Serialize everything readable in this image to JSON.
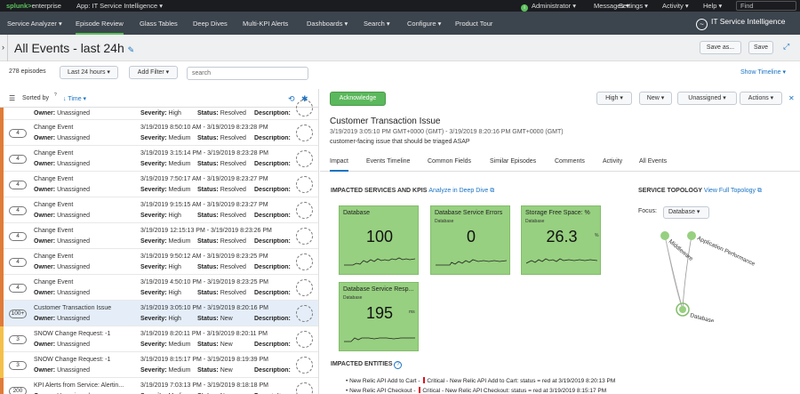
{
  "topbar": {
    "logo_a": "splunk>",
    "logo_b": "enterprise",
    "app": "App: IT Service Intelligence ▾",
    "admin_icon": "i",
    "admin": "Administrator ▾",
    "messages": "Messages ▾",
    "settings": "Settings ▾",
    "activity": "Activity ▾",
    "help": "Help ▾",
    "find": "Find"
  },
  "nav": {
    "items": [
      "Service Analyzer ▾",
      "Episode Review",
      "Glass Tables",
      "Deep Dives",
      "Multi-KPI Alerts",
      "Dashboards ▾",
      "Search ▾",
      "Configure ▾",
      "Product Tour"
    ],
    "brand": "IT Service Intelligence",
    "brand_icon": "~"
  },
  "title": {
    "text": "All Events - last 24h",
    "edit_icon": "✎",
    "save_as": "Save as...",
    "save": "Save",
    "expand_icon": "⤢"
  },
  "toolbar": {
    "count": "278 episodes",
    "time": "Last 24 hours ▾",
    "filter": "Add Filter ▾",
    "search_placeholder": "search",
    "show_timeline": "Show Timeline ▾"
  },
  "list": {
    "sort_icon": "☰",
    "sorted_by": "Sorted by",
    "sort_q": "?",
    "sort_field": "↓ Time ▾",
    "refresh_icon": "⟲",
    "settings_icon": "✱",
    "labels": {
      "owner": "Owner:",
      "severity": "Severity:",
      "status": "Status:",
      "description": "Description:"
    },
    "rows": [
      {
        "badge": "",
        "title": "",
        "time": "",
        "owner": "Unassigned",
        "severity": "High",
        "status": "Resolved",
        "desc": "",
        "color": "#e07b39"
      },
      {
        "badge": "4",
        "title": "Change Event",
        "time": "3/19/2019 8:50:10 AM - 3/19/2019 8:23:28 PM",
        "owner": "Unassigned",
        "severity": "Medium",
        "status": "Resolved",
        "desc": "",
        "color": "#e07b39"
      },
      {
        "badge": "4",
        "title": "Change Event",
        "time": "3/19/2019 3:15:14 PM - 3/19/2019 8:23:28 PM",
        "owner": "Unassigned",
        "severity": "Medium",
        "status": "Resolved",
        "desc": "",
        "color": "#e07b39"
      },
      {
        "badge": "4",
        "title": "Change Event",
        "time": "3/19/2019 7:50:17 AM - 3/19/2019 8:23:27 PM",
        "owner": "Unassigned",
        "severity": "Medium",
        "status": "Resolved",
        "desc": "",
        "color": "#e07b39"
      },
      {
        "badge": "4",
        "title": "Change Event",
        "time": "3/19/2019 9:15:15 AM - 3/19/2019 8:23:27 PM",
        "owner": "Unassigned",
        "severity": "High",
        "status": "Resolved",
        "desc": "",
        "color": "#e07b39"
      },
      {
        "badge": "4",
        "title": "Change Event",
        "time": "3/19/2019 12:15:13 PM - 3/19/2019 8:23:26 PM",
        "owner": "Unassigned",
        "severity": "Medium",
        "status": "Resolved",
        "desc": "",
        "color": "#e07b39"
      },
      {
        "badge": "4",
        "title": "Change Event",
        "time": "3/19/2019 9:50:12 AM - 3/19/2019 8:23:25 PM",
        "owner": "Unassigned",
        "severity": "High",
        "status": "Resolved",
        "desc": "",
        "color": "#e07b39"
      },
      {
        "badge": "4",
        "title": "Change Event",
        "time": "3/19/2019 4:50:10 PM - 3/19/2019 8:23:25 PM",
        "owner": "Unassigned",
        "severity": "High",
        "status": "Resolved",
        "desc": "",
        "color": "#e07b39"
      },
      {
        "badge": "100+",
        "title": "Customer Transaction Issue",
        "time": "3/19/2019 3:05:10 PM - 3/19/2019 8:20:16 PM",
        "owner": "Unassigned",
        "severity": "High",
        "status": "New",
        "desc": "custo...",
        "color": "#e07b39",
        "selected": true
      },
      {
        "badge": "3",
        "title": "SNOW Change Request: -1",
        "time": "3/19/2019 8:20:11 PM - 3/19/2019 8:20:11 PM",
        "owner": "Unassigned",
        "severity": "Medium",
        "status": "New",
        "desc": "SNOW Change...",
        "color": "#f5c04a"
      },
      {
        "badge": "3",
        "title": "SNOW Change Request: -1",
        "time": "3/19/2019 8:15:17 PM - 3/19/2019 8:19:39 PM",
        "owner": "Unassigned",
        "severity": "Medium",
        "status": "New",
        "desc": "SNOW Change...",
        "color": "#f5c04a"
      },
      {
        "badge": "200",
        "title": "KPI Alerts from Service: Alertin...",
        "time": "3/19/2019 7:03:13 PM - 3/19/2019 8:18:18 PM",
        "owner": "Unassigned",
        "severity": "Medium",
        "status": "New",
        "desc": "",
        "color": "#e07b39"
      }
    ]
  },
  "detail": {
    "ack": "Acknowledge",
    "high": "High ▾",
    "new": "New ▾",
    "unassigned": "Unassigned ▾",
    "actions": "Actions ▾",
    "close_icon": "✕",
    "title": "Customer Transaction Issue",
    "time": "3/19/2019 3:05:10 PM GMT+0000 (GMT) - 3/19/2019 8:20:16 PM GMT+0000 (GMT)",
    "desc": "customer-facing issue that should be triaged ASAP",
    "tabs": [
      "Impact",
      "Events Timeline",
      "Common Fields",
      "Similar Episodes",
      "Comments",
      "Activity",
      "All Events"
    ],
    "impacted_title": "IMPACTED SERVICES AND KPIS",
    "analyze": "Analyze in Deep Dive ⧉",
    "kpis": [
      {
        "title": "Database",
        "sub": "",
        "value": "100",
        "unit": ""
      },
      {
        "title": "Database Service Errors",
        "sub": "Database",
        "value": "0",
        "unit": ""
      },
      {
        "title": "Storage Free Space: %",
        "sub": "Database",
        "value": "26.3",
        "unit": "%"
      },
      {
        "title": "Database Service Resp...",
        "sub": "Database",
        "value": "195",
        "unit": "ms"
      }
    ],
    "topology_title": "SERVICE TOPOLOGY",
    "topology_link": "View Full Topology ⧉",
    "focus_label": "Focus:",
    "focus_value": "Database ▾",
    "topo_nodes": [
      "Middleware",
      "Application Performance",
      "Database"
    ],
    "entities_title": "IMPACTED ENTITIES",
    "info_icon": "?",
    "entities": [
      {
        "a": "• New Relic API Add to Cart - ",
        "b": "Critical - New Relic API Add to Cart: status = red at 3/19/2019 8:20:13 PM"
      },
      {
        "a": "• New Relic API Checkout - ",
        "b": "Critical - New Relic API Checkout: status = red at 3/19/2019 8:15:17 PM"
      }
    ]
  }
}
